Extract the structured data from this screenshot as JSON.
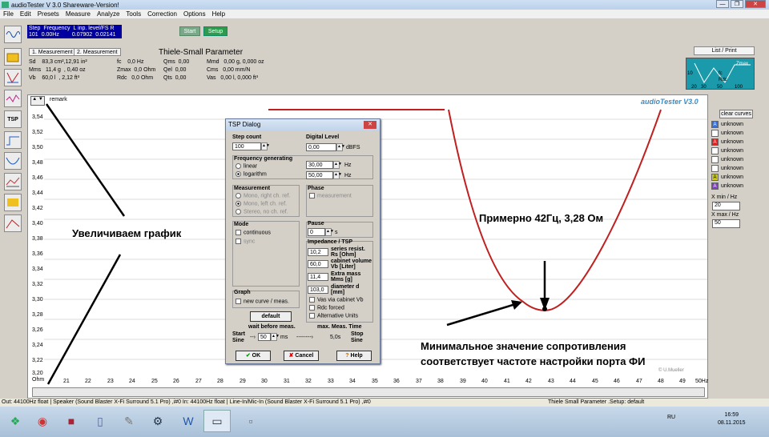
{
  "window": {
    "title": "audioTester  V 3.0 Shareware-Version!",
    "min": "—",
    "max": "❐",
    "close": "✕"
  },
  "menu": [
    "File",
    "Edit",
    "Presets",
    "Measure",
    "Analyze",
    "Tools",
    "Correction",
    "Options",
    "Help"
  ],
  "status_blue": {
    "row1": [
      "Step",
      "Frequency",
      "L inp. level/FS R"
    ],
    "row2": [
      "101",
      "0.00Hz",
      "0.07902",
      "0.02141"
    ]
  },
  "buttons": {
    "start": "Start",
    "setup": "Setup",
    "list_print": "List / Print",
    "clear_curves": "clear curves"
  },
  "tabs": [
    "1. Measurement",
    "2. Measurement"
  ],
  "tsp_title": "Thiele-Small Parameter",
  "params": {
    "col1": "Sd    83,3 cm²,12,91 in²\nMms   11,4 g  , 0,40 oz\nVb    60,0 l  , 2,12 ft³",
    "col2": "fc    0,0 Hz\nZmax  0,0 Ohm\nRdc   0,0 Ohm",
    "col3": "Qms  0,00\nQel  0,00\nQts  0,00",
    "col4": "Mmd   0,00 g, 0,000 oz\nCms   0,00 mm/N\nVas   0,00 l, 0,000 ft³"
  },
  "mini_graph": {
    "labels": [
      "Zmax",
      "10",
      "fc",
      "Rdc",
      "20",
      "30",
      "50",
      "100"
    ]
  },
  "remark": {
    "arrows": "▲ ▼",
    "label": "remark"
  },
  "brand": "audioTester  V3.0",
  "channels": [
    {
      "badge": "A",
      "label": "unknown",
      "color": "#3a6fd8"
    },
    {
      "badge": "",
      "label": "unknown",
      "color": "#ffffff"
    },
    {
      "badge": "A",
      "label": "unknown",
      "color": "#e02020"
    },
    {
      "badge": "",
      "label": "unknown",
      "color": "#ffffff"
    },
    {
      "badge": "",
      "label": "unknown",
      "color": "#ffffff"
    },
    {
      "badge": "",
      "label": "unknown",
      "color": "#ffffff"
    },
    {
      "badge": "A",
      "label": "unknown",
      "color": "#c8c820"
    },
    {
      "badge": "A",
      "label": "unknown",
      "color": "#8040c0"
    }
  ],
  "xrange": {
    "min_label": "X min / Hz",
    "min": "20",
    "max_label": "X max / Hz",
    "max": "50"
  },
  "y_axis": {
    "ticks": [
      "3,54",
      "3,52",
      "3,50",
      "3,48",
      "3,46",
      "3,44",
      "3,42",
      "3,40",
      "3,38",
      "3,36",
      "3,34",
      "3,32",
      "3,30",
      "3,28",
      "3,26",
      "3,24",
      "3,22",
      "3,20"
    ],
    "bottom": "3,20",
    "unit": "Ohm"
  },
  "x_axis": {
    "ticks": [
      "21",
      "22",
      "23",
      "24",
      "25",
      "26",
      "27",
      "28",
      "29",
      "30",
      "31",
      "32",
      "33",
      "34",
      "35",
      "36",
      "37",
      "38",
      "39",
      "40",
      "41",
      "42",
      "43",
      "44",
      "45",
      "46",
      "47",
      "48",
      "49"
    ],
    "end": "50Hz"
  },
  "copyright": "© U.Mueller",
  "dialog": {
    "title": "TSP Dialog",
    "close": "✕",
    "step_count_label": "Step count",
    "step_count": "100",
    "digital_level_label": "Digital Level",
    "digital_level": "0,00",
    "dbfs": "dBFS",
    "freq_gen_label": "Frequency generating",
    "linear": "linear",
    "logarithm": "logarithm",
    "f1": "30,00",
    "f2": "50,00",
    "hz": "Hz",
    "measurement_label": "Measurement",
    "m1": "Mono, right ch. ref.",
    "m2": "Mono, left ch. ref.",
    "m3": "Stereo, no ch. ref.",
    "phase_label": "Phase",
    "phase_meas": "measurement",
    "mode_label": "Mode",
    "continuous": "continuous",
    "sync": "sync",
    "pause_label": "Pause",
    "pause": "0",
    "s": "s",
    "imp_label": "Impedance / TSP",
    "series": "10,2",
    "series_label": "series resist. Rs [Ohm]",
    "cabinet": "60,0",
    "cabinet_label": "cabinet volume Vb [Liter]",
    "mass": "11,4",
    "mass_label": "Extra mass Mms [g]",
    "diameter": "103,0",
    "diameter_label": "diameter d [mm]",
    "vas_cb": "Vas via cabinet Vb",
    "rdc_cb": "Rdc forced",
    "alt_units": "Alternative Units",
    "graph_label": "Graph",
    "new_curve": "new curve / meas.",
    "default": "default",
    "wait_label": "wait before meas.",
    "max_label": "max. Meas. Time",
    "start_sine": "Start Sine",
    "wait_val": "50",
    "ms": "ms",
    "max_val": "5,0s",
    "stop_sine": "Stop Sine",
    "ok": "OK",
    "cancel": "Cancel",
    "help": "Help"
  },
  "annotations": {
    "zoom": "Увеличиваем график",
    "approx": "Примерно 42Гц, 3,28 Ом",
    "min1": "Минимальное значение сопротивления",
    "min2": "соответствует частоте настройки порта ФИ"
  },
  "statusbar": {
    "left": "Out: 44100Hz float  | Speaker (Sound Blaster X-Fi Surround 5.1 Pro) ,i#0  In: 44100Hz float  | Line-In/Mic-In (Sound Blaster X-Fi Surround 5.1 Pro) ,i#0",
    "right": "Thiele Small Parameter  .Setup:  default"
  },
  "taskbar": {
    "lang": "RU",
    "time": "16:59",
    "date": "08.11.2015"
  }
}
